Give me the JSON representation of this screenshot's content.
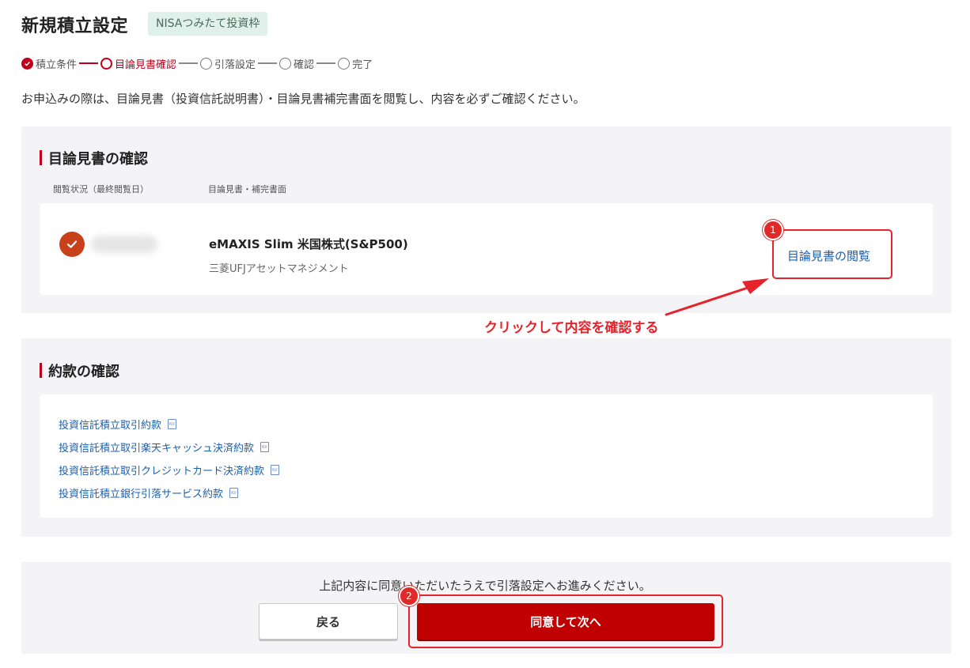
{
  "header": {
    "title": "新規積立設定",
    "tag": "NISAつみたて投資枠"
  },
  "stepper": {
    "steps": [
      {
        "label": "積立条件",
        "state": "done"
      },
      {
        "label": "目論見書確認",
        "state": "current"
      },
      {
        "label": "引落設定",
        "state": "upcoming"
      },
      {
        "label": "確認",
        "state": "upcoming"
      },
      {
        "label": "完了",
        "state": "upcoming"
      }
    ]
  },
  "intro_text": "お申込みの際は、目論見書（投資信託説明書）・目論見書補完書面を閲覧し、内容を必ずご確認ください。",
  "prospectus_section": {
    "heading": "目論見書の確認",
    "col_status": "閲覧状況（最終閲覧日）",
    "col_document": "目論見書・補完書面",
    "fund_name": "eMAXIS Slim 米国株式(S&P500)",
    "fund_company": "三菱UFJアセットマネジメント",
    "view_link": "目論見書の閲覧"
  },
  "annotations": {
    "marker_1": "1",
    "marker_2": "2",
    "callout": "クリックして内容を確認する",
    "accent_color": "#e8222b"
  },
  "terms_section": {
    "heading": "約款の確認",
    "items": [
      "投資信託積立取引約款",
      "投資信託積立取引楽天キャッシュ決済約款",
      "投資信託積立取引クレジットカード決済約款",
      "投資信託積立銀行引落サービス約款"
    ]
  },
  "footer": {
    "note": "上記内容に同意いただいたうえで引落設定へお進みください。",
    "back_label": "戻る",
    "next_label": "同意して次へ"
  },
  "colors": {
    "brand_red": "#c00000",
    "link_blue": "#1d5fae",
    "panel_bg": "#f4f4f6"
  }
}
